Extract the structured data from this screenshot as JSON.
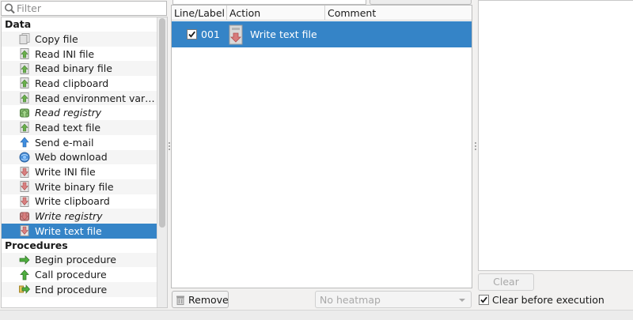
{
  "filter": {
    "placeholder": "Filter",
    "value": ""
  },
  "categories": [
    {
      "name": "Data",
      "items": [
        {
          "label": "Copy file",
          "icon": "copy-file-icon",
          "italic": false,
          "selected": false
        },
        {
          "label": "Read INI file",
          "icon": "read-ini-file-icon",
          "italic": false,
          "selected": false
        },
        {
          "label": "Read binary file",
          "icon": "read-binary-file-icon",
          "italic": false,
          "selected": false
        },
        {
          "label": "Read clipboard",
          "icon": "read-clipboard-icon",
          "italic": false,
          "selected": false
        },
        {
          "label": "Read environment vari…",
          "icon": "read-environment-icon",
          "italic": false,
          "selected": false
        },
        {
          "label": "Read registry",
          "icon": "read-registry-icon",
          "italic": true,
          "selected": false
        },
        {
          "label": "Read text file",
          "icon": "read-text-file-icon",
          "italic": false,
          "selected": false
        },
        {
          "label": "Send e-mail",
          "icon": "send-email-icon",
          "italic": false,
          "selected": false
        },
        {
          "label": "Web download",
          "icon": "web-download-icon",
          "italic": false,
          "selected": false
        },
        {
          "label": "Write INI file",
          "icon": "write-ini-file-icon",
          "italic": false,
          "selected": false
        },
        {
          "label": "Write binary file",
          "icon": "write-binary-file-icon",
          "italic": false,
          "selected": false
        },
        {
          "label": "Write clipboard",
          "icon": "write-clipboard-icon",
          "italic": false,
          "selected": false
        },
        {
          "label": "Write registry",
          "icon": "write-registry-icon",
          "italic": true,
          "selected": false
        },
        {
          "label": "Write text file",
          "icon": "write-text-file-icon",
          "italic": false,
          "selected": true
        }
      ]
    },
    {
      "name": "Procedures",
      "items": [
        {
          "label": "Begin procedure",
          "icon": "begin-procedure-icon",
          "italic": false,
          "selected": false
        },
        {
          "label": "Call procedure",
          "icon": "call-procedure-icon",
          "italic": false,
          "selected": false
        },
        {
          "label": "End procedure",
          "icon": "end-procedure-icon",
          "italic": false,
          "selected": false
        }
      ]
    }
  ],
  "table": {
    "headers": [
      "Line/Label",
      "Action",
      "Comment"
    ],
    "rows": [
      {
        "checked": true,
        "line": "001",
        "action": "Write text file",
        "comment": "",
        "icon": "write-text-file-icon"
      }
    ]
  },
  "bottom": {
    "remove_label": "Remove",
    "heatmap_value": "No heatmap"
  },
  "output": {
    "clear_label": "Clear",
    "clear_before_label": "Clear before execution",
    "clear_before_checked": true
  },
  "colors": {
    "selection": "#3584c7",
    "window_bg": "#f2f1f0"
  }
}
